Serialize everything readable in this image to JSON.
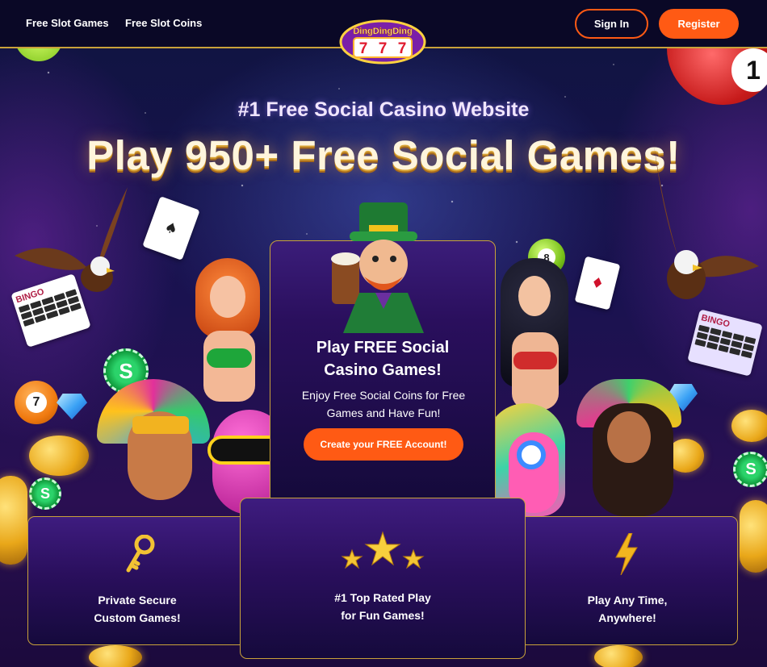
{
  "nav": {
    "links": [
      "Free Slot Games",
      "Free Slot Coins"
    ],
    "logo_text": [
      "Ding",
      "Ding",
      "Ding",
      "7",
      "7",
      "7"
    ],
    "signin_label": "Sign In",
    "register_label": "Register"
  },
  "hero": {
    "subtitle": "#1 Free Social Casino Website",
    "title": "Play 950+ Free Social Games!"
  },
  "decor": {
    "ball_left": "7",
    "ball_right": "1",
    "bingo_label": "BINGO",
    "chip_label": "S",
    "card_suit": "♠",
    "card_suit2": "♦",
    "ball_top_left": "8"
  },
  "center_card": {
    "title_line1": "Play FREE Social",
    "title_line2": "Casino Games!",
    "text_line1": "Enjoy Free Social Coins for Free",
    "text_line2": "Games and Have Fun!",
    "cta_label": "Create your FREE Account!"
  },
  "features": [
    {
      "icon": "key-icon",
      "line1": "Private Secure",
      "line2": "Custom Games!"
    },
    {
      "icon": "three-stars-icon",
      "line1": "#1 Top Rated Play",
      "line2": "for Fun Games!"
    },
    {
      "icon": "lightning-icon",
      "line1": "Play Any Time,",
      "line2": "Anywhere!"
    }
  ],
  "colors": {
    "accent": "#ff5a14",
    "gold": "#c9a23a",
    "nav_bg": "#0a0826"
  }
}
